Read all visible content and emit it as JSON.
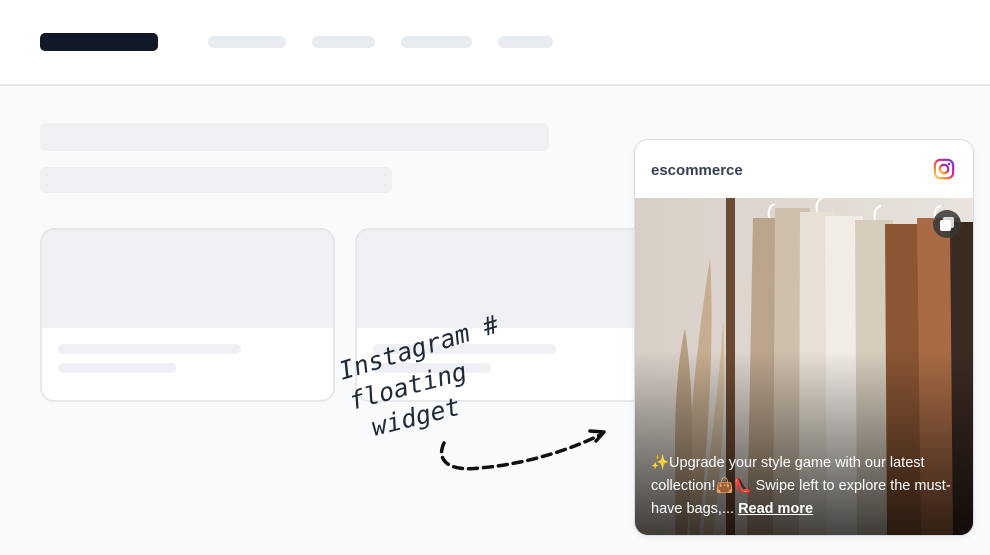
{
  "widget": {
    "username": "escommerce",
    "caption_text": "✨Upgrade your style game with our latest collection!👜👠 Swipe left to explore the must-have bags,...",
    "read_more_label": "Read more"
  },
  "annotation": {
    "line1": "Instagram #",
    "line2": "floating",
    "line3": "widget"
  },
  "icons": {
    "instagram": "instagram-icon",
    "carousel": "multiple-images-icon"
  },
  "colors": {
    "logo": "#111827",
    "skeleton": "#eef0f3",
    "instagram_gradient": [
      "#feda75",
      "#fa7e1e",
      "#d62976",
      "#962fbf",
      "#4f5bd5"
    ]
  }
}
